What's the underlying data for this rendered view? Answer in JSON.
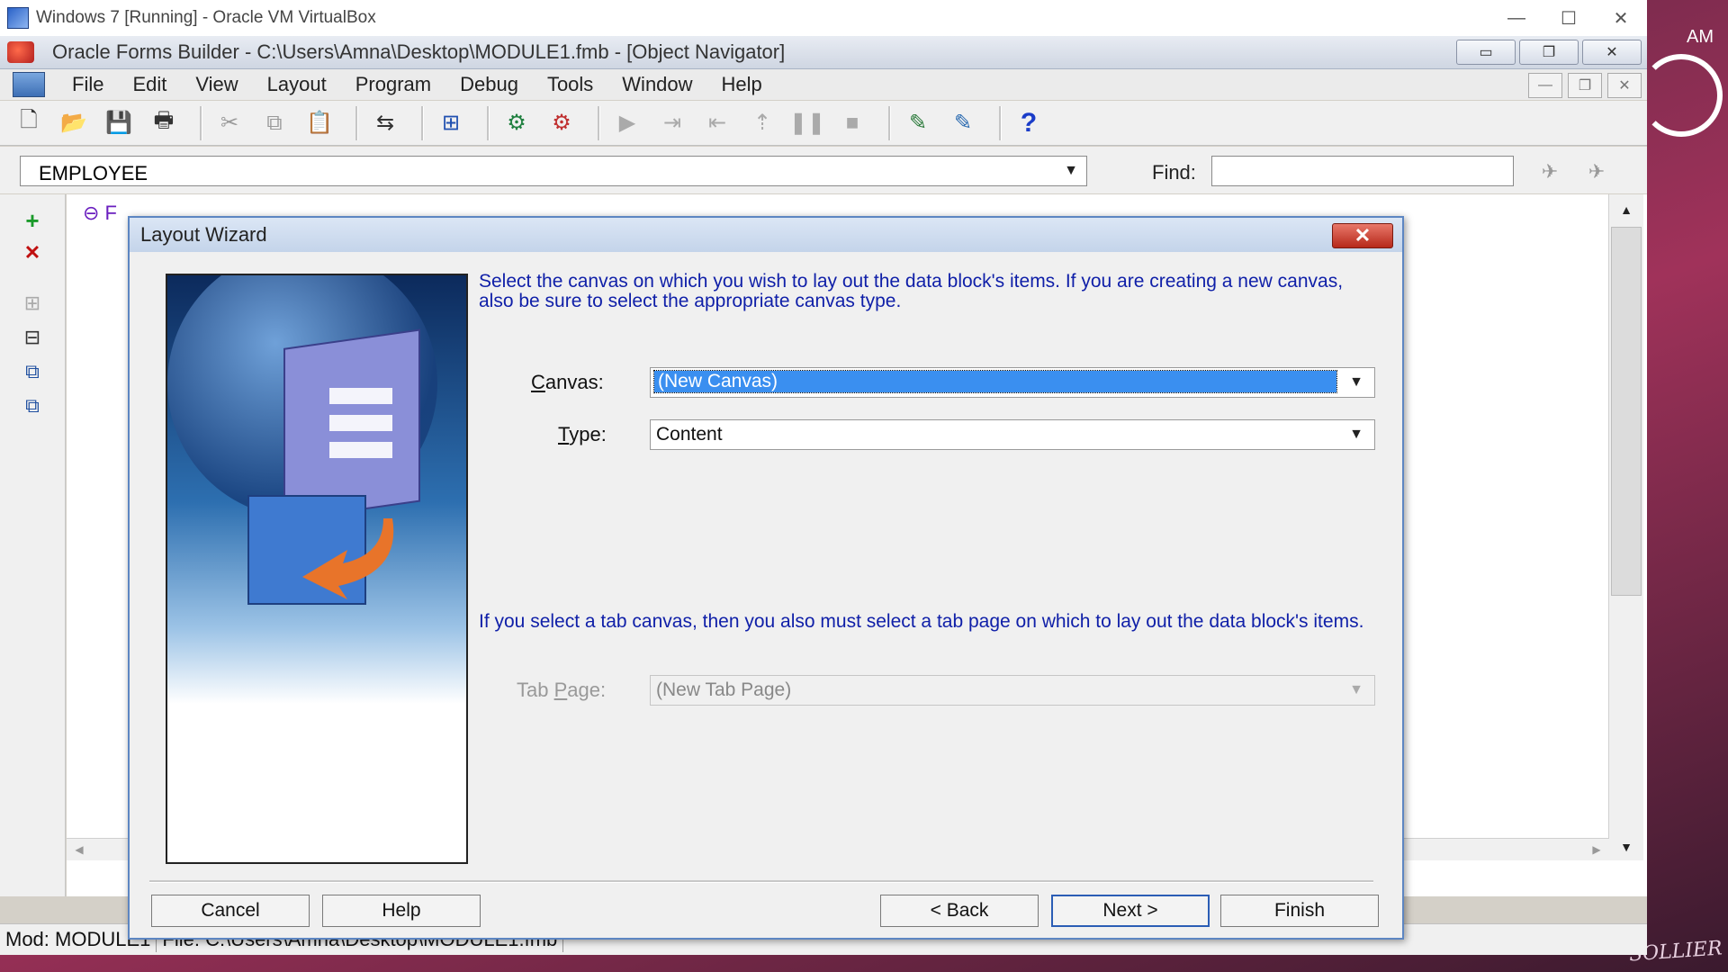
{
  "host": {
    "window_title": "Windows 7 [Running] - Oracle VM VirtualBox",
    "controls": {
      "minimize": "—",
      "maximize": "☐",
      "close": "✕"
    },
    "clock_text": "AM",
    "desktop_signature": "SOLLIER"
  },
  "app": {
    "title": "Oracle Forms Builder - C:\\Users\\Amna\\Desktop\\MODULE1.fmb - [Object Navigator]",
    "menus": [
      "File",
      "Edit",
      "View",
      "Layout",
      "Program",
      "Debug",
      "Tools",
      "Window",
      "Help"
    ]
  },
  "navigator": {
    "module_combo_value": "EMPLOYEE",
    "find_label": "Find:",
    "find_value": "",
    "tree_node_label": "F"
  },
  "status": {
    "mod": "Mod: MODULE1",
    "file": "File: C:\\Users\\Amna\\Desktop\\MODULE1.fmb"
  },
  "wizard": {
    "title": "Layout Wizard",
    "instruction_1": "Select the canvas on which you wish to lay out the data block's items. If you are creating a new canvas, also be sure to select the appropriate canvas type.",
    "canvas_label_accel": "C",
    "canvas_label_rest": "anvas:",
    "canvas_value": "(New Canvas)",
    "type_label_accel": "T",
    "type_label_rest": "ype:",
    "type_value": "Content",
    "instruction_2": "If you select a tab canvas, then you also must select a tab page on which to lay out the data block's items.",
    "tabpage_label_pre": "Tab ",
    "tabpage_label_accel": "P",
    "tabpage_label_rest": "age:",
    "tabpage_value": "(New Tab Page)",
    "buttons": {
      "cancel": "Cancel",
      "help": "Help",
      "back": "< Back",
      "next": "Next >",
      "finish": "Finish"
    }
  },
  "colors": {
    "wizard_text": "#0f1fa8",
    "selection": "#3a8ff0",
    "tree_node": "#6a1fbf"
  }
}
